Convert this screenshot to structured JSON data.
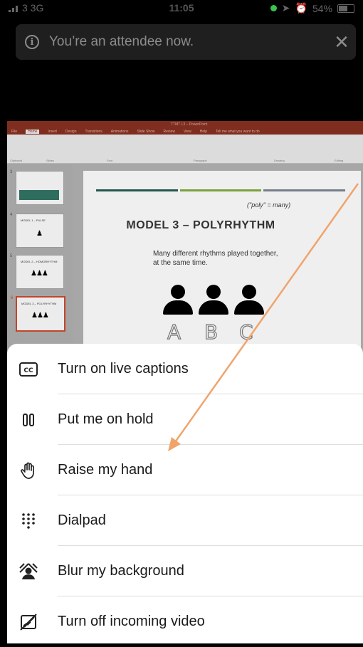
{
  "status_bar": {
    "carrier": "3  3G",
    "time": "11:05",
    "battery": "54%"
  },
  "banner": {
    "message": "You’re an attendee now.",
    "info_icon": "info-icon",
    "close_icon": "close-icon"
  },
  "shared_screen": {
    "app": "PowerPoint",
    "window_title": "TTMT L3 – PowerPoint",
    "tabs": [
      "File",
      "Home",
      "Insert",
      "Design",
      "Transitions",
      "Animations",
      "Slide Show",
      "Review",
      "View",
      "Help",
      "Tell me what you want to do"
    ],
    "ribbon_groups": [
      "Clipboard",
      "Slides",
      "Font",
      "Paragraph",
      "Drawing",
      "Editing"
    ],
    "thumbnails": [
      {
        "number": "3"
      },
      {
        "number": "4",
        "title": "MODEL 1 – PULSE"
      },
      {
        "number": "5",
        "title": "MODEL 2 – HOMORHYTHM"
      },
      {
        "number": "6",
        "title": "MODEL 3 – POLYRHYTHM"
      }
    ],
    "slide": {
      "note": "(\"poly\" = many)",
      "title": "MODEL 3 – POLYRHYTHM",
      "description_line1": "Many different rhythms played together,",
      "description_line2": "at the same time.",
      "letters": [
        "A",
        "B",
        "C"
      ],
      "bar_colors": [
        "#24554a",
        "#7aa23d",
        "#767d8a"
      ]
    }
  },
  "annotation": {
    "arrow_color": "#f0a46c"
  },
  "menu": {
    "items": [
      {
        "label": "Turn on live captions",
        "icon": "closed-captions-icon"
      },
      {
        "label": "Put me on hold",
        "icon": "pause-icon"
      },
      {
        "label": "Raise my hand",
        "icon": "raise-hand-icon"
      },
      {
        "label": "Dialpad",
        "icon": "dialpad-icon"
      },
      {
        "label": "Blur my background",
        "icon": "blur-background-icon"
      },
      {
        "label": "Turn off incoming video",
        "icon": "video-off-icon"
      }
    ]
  }
}
